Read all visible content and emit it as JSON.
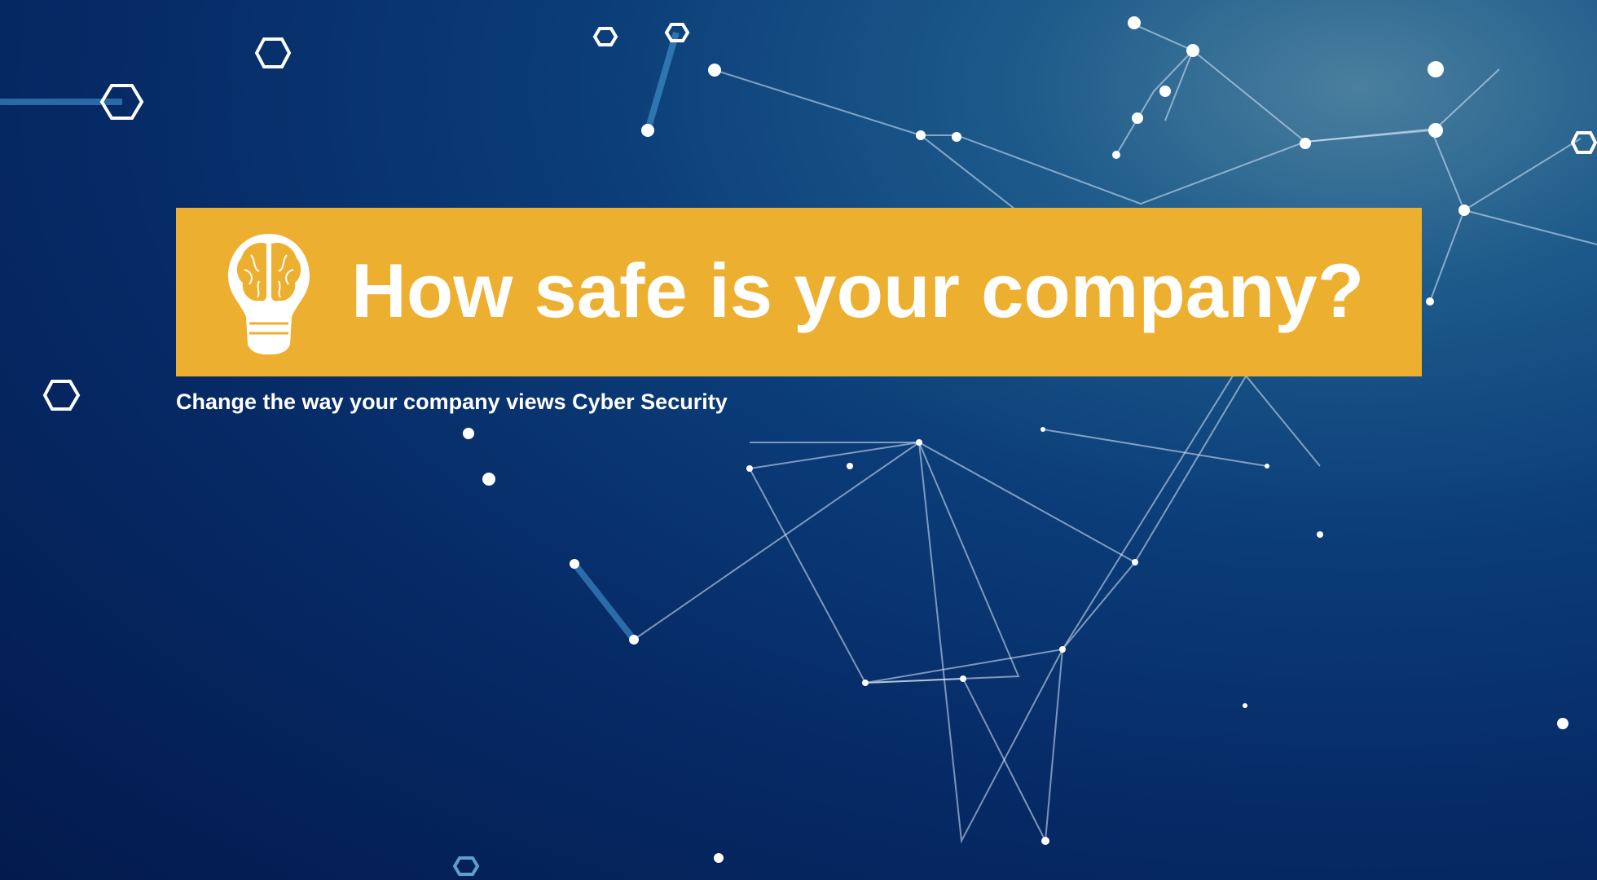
{
  "banner": {
    "title": "How safe is your company?",
    "icon": "brain-lightbulb-icon",
    "color": "#edaf2f"
  },
  "subtitle": "Change the way your company views Cyber Security",
  "background": {
    "theme": "network-nodes",
    "color": "#062a66"
  }
}
